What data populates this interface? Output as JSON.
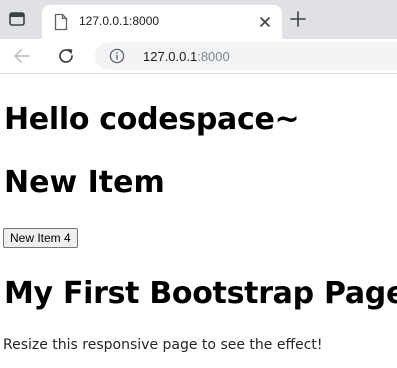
{
  "browser": {
    "tab_title": "127.0.0.1:8000",
    "url_host": "127.0.0.1",
    "url_port": ":8000",
    "icons": {
      "tab_menu": "tab-menu-icon",
      "page": "page-icon",
      "close": "close-icon",
      "new_tab": "plus-icon",
      "back": "back-arrow-icon",
      "reload": "reload-icon",
      "info": "info-icon"
    }
  },
  "page": {
    "heading_1": "Hello codespace~",
    "heading_2": "New Item",
    "button_label": "New Item 4",
    "heading_3": "My First Bootstrap Page",
    "paragraph": "Resize this responsive page to see the effect!"
  }
}
